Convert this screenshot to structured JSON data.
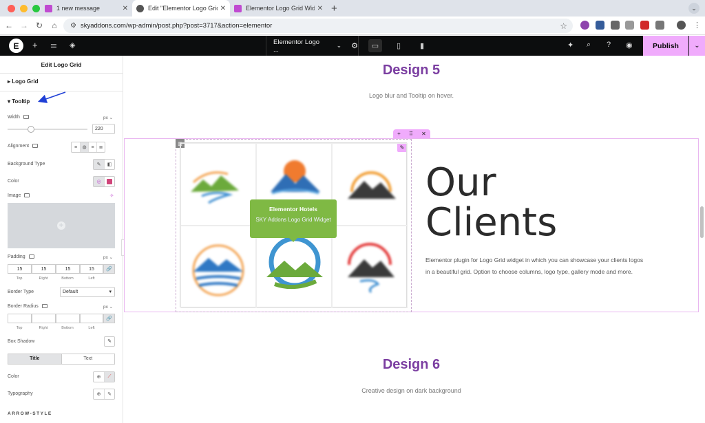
{
  "browser": {
    "tabs": [
      {
        "title": "1 new message"
      },
      {
        "title": "Edit \"Elementor Logo Grid W"
      },
      {
        "title": "Elementor Logo Grid Widget"
      }
    ],
    "url": "skyaddons.com/wp-admin/post.php?post=3717&action=elementor"
  },
  "topbar": {
    "doc_title": "Elementor Logo ...",
    "publish": "Publish"
  },
  "panel": {
    "title": "Edit Logo Grid",
    "logo_grid": "Logo Grid",
    "tooltip": "Tooltip",
    "width_label": "Width",
    "width_unit": "px",
    "width_value": "220",
    "width_fraction": 0.29,
    "alignment_label": "Alignment",
    "background_type_label": "Background Type",
    "color_label": "Color",
    "image_label": "Image",
    "padding_label": "Padding",
    "padding_unit": "px",
    "padding_values": [
      "15",
      "15",
      "15",
      "15"
    ],
    "side_labels": [
      "Top",
      "Right",
      "Bottom",
      "Left"
    ],
    "border_type_label": "Border Type",
    "border_type_value": "Default",
    "border_radius_label": "Border Radius",
    "border_radius_unit": "px",
    "box_shadow_label": "Box Shadow",
    "tabs": [
      "Title",
      "Text"
    ],
    "color2_label": "Color",
    "typography_label": "Typography",
    "arrow_style": "ARROW-STYLE"
  },
  "canvas": {
    "design5_title": "Design 5",
    "design5_sub": "Logo blur and Tooltip on hover.",
    "tooltip_title": "Elementor Hotels",
    "tooltip_text": "SKY Addons Logo Grid Widget",
    "clients_line1": "Our",
    "clients_line2": "Clients",
    "clients_desc": "Elementor plugin for Logo Grid widget in which you can showcase your clients logos in a beautiful grid. Option to choose columns, logo type, gallery mode and more.",
    "design6_title": "Design 6",
    "design6_sub": "Creative design on dark background"
  },
  "colors": {
    "accent_purple": "#7b3ea1",
    "publish_pink": "#f0abfc",
    "tooltip_green": "#7fb944",
    "annotation_blue": "#1f3fd6"
  }
}
